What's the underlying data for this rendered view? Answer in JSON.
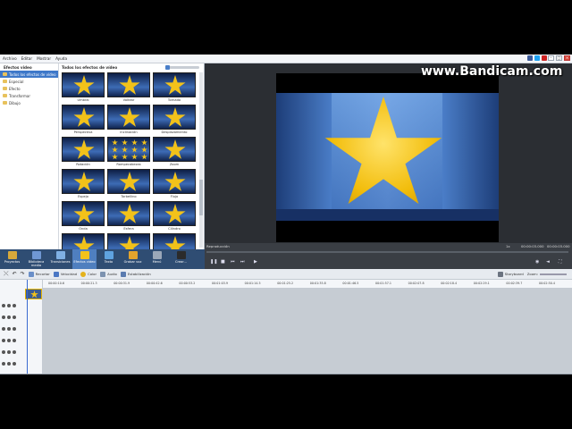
{
  "menu": [
    "Archivo",
    "Editar",
    "Mostrar",
    "Ayuda"
  ],
  "watermark": "www.Bandicam.com",
  "categories": {
    "title": "Efectos video",
    "items": [
      "Todos los efectos de vídeo",
      "Especial",
      "Efecto",
      "Transformar",
      "Dibujo"
    ],
    "selected": 0
  },
  "gallery": {
    "title": "Todos los efectos de vídeo",
    "captions": [
      "Umbral",
      "Voltear",
      "Tornado",
      "Perspectiva",
      "Inclinación",
      "Desplazamiento",
      "Rotación",
      "Rompecabezas",
      "Zoom",
      "Espejo",
      "Torbellino",
      "Flujo",
      "Onda",
      "Esfera",
      "Cilindro",
      "",
      "",
      ""
    ]
  },
  "toolbar": {
    "items": [
      "Proyectos",
      "Biblioteca media",
      "Transiciones",
      "Efectos video",
      "Texto",
      "Grabar voz",
      "Menú",
      "Crear..."
    ],
    "selected": 3
  },
  "preview": {
    "label": "Reproducción",
    "speed": "1x",
    "time_current": "00:00:03.000",
    "time_total": "00:00:03.000"
  },
  "timeline_tools": [
    "Recortar",
    "Velocidad",
    "Color",
    "Audio",
    "Estabilización"
  ],
  "timeline_right": {
    "storyboard": "Storyboard",
    "zoom": "Zoom:"
  },
  "ruler": [
    "00:00:10.6",
    "00:00:21.3",
    "00:00:31.9",
    "00:00:42.6",
    "00:00:53.2",
    "00:01:03.9",
    "00:01:14.5",
    "00:01:25.2",
    "00:01:35.8",
    "00:01:46.5",
    "00:01:57.1",
    "00:02:07.8",
    "00:02:18.4",
    "00:02:29.1",
    "00:02:39.7",
    "00:02:50.4"
  ],
  "colors": {
    "accent": "#3e78c9",
    "toolbar": "#2f4d73",
    "star": "#f2c21a"
  }
}
